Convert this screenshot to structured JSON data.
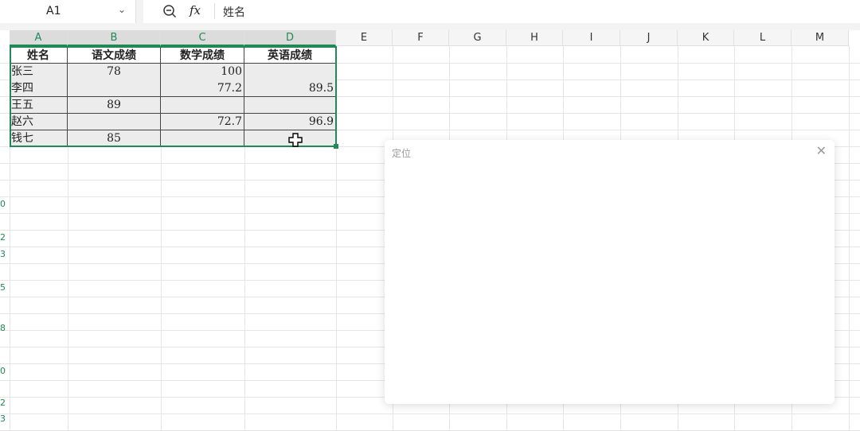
{
  "formula_bar": {
    "cell_ref": "A1",
    "formula": "姓名"
  },
  "columns": [
    "A",
    "B",
    "C",
    "D",
    "E",
    "F",
    "G",
    "H",
    "I",
    "J",
    "K",
    "L",
    "M"
  ],
  "selected_columns": [
    "A",
    "B",
    "C",
    "D"
  ],
  "table": {
    "headers": [
      "姓名",
      "语文成绩",
      "数学成绩",
      "英语成绩"
    ],
    "rows": [
      [
        "张三",
        "78",
        "100",
        ""
      ],
      [
        "李四",
        "",
        "77.2",
        "89.5"
      ],
      [
        "王五",
        "89",
        "",
        ""
      ],
      [
        "赵六",
        "",
        "72.7",
        "96.9"
      ],
      [
        "钱七",
        "85",
        "",
        ""
      ]
    ]
  },
  "row_number_fragments": [
    "0",
    "2",
    "3",
    "5",
    "8",
    "0",
    "2",
    "3"
  ],
  "dialog": {
    "title": "定位",
    "close_icon": "close-icon"
  },
  "colors": {
    "accent": "#1f8a55",
    "cell_fill": "#ececec"
  }
}
